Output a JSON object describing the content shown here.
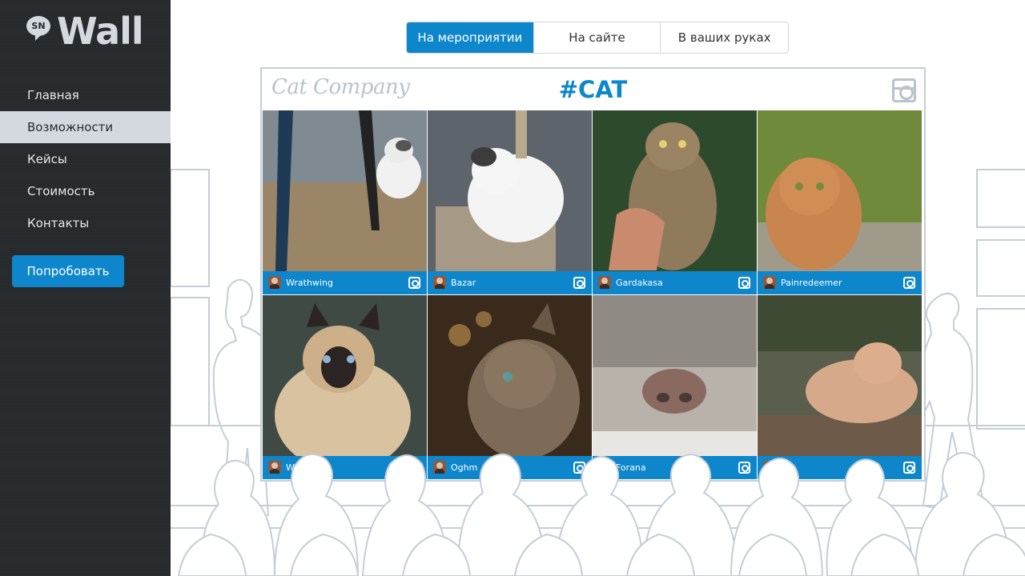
{
  "logo": {
    "badge": "SN",
    "text": "Wall"
  },
  "nav": {
    "items": [
      "Главная",
      "Возможности",
      "Кейсы",
      "Стоимость",
      "Контакты"
    ],
    "active_index": 1
  },
  "try_button": "Попробовать",
  "tabs": {
    "items": [
      "На мероприятии",
      "На сайте",
      "В ваших руках"
    ],
    "active_index": 0
  },
  "wall": {
    "brand": "Cat Company",
    "hashtag": "#CAT",
    "posts": [
      {
        "user": "Wrathwing"
      },
      {
        "user": "Bazar"
      },
      {
        "user": "Gardakasa"
      },
      {
        "user": "Painredeemer"
      },
      {
        "user": "Wra"
      },
      {
        "user": "Oghm"
      },
      {
        "user": "Forana"
      },
      {
        "user": "riel"
      }
    ]
  },
  "colors": {
    "accent": "#0d86cc",
    "sidebar": "#262a2d",
    "sketch": "#c4ced6"
  }
}
